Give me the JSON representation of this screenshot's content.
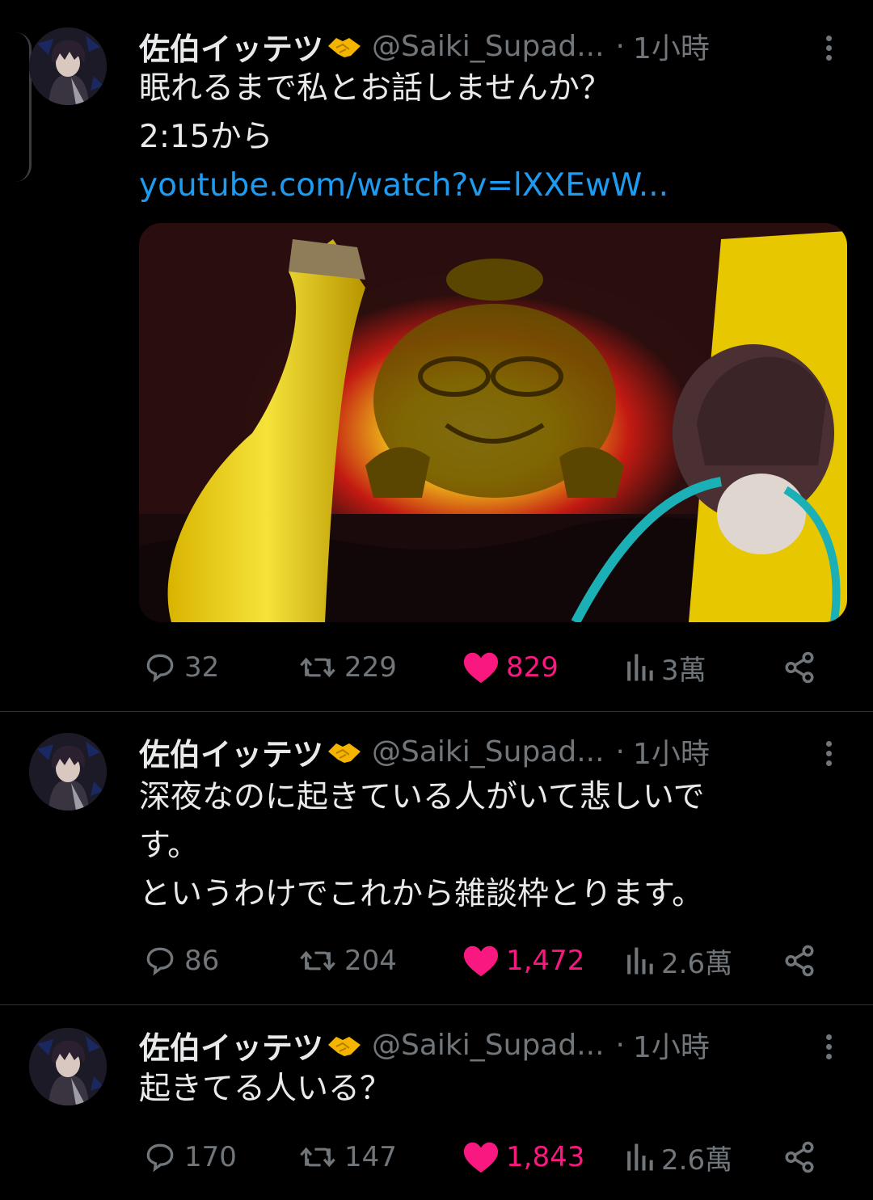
{
  "colors": {
    "background": "#000000",
    "text": "#e7e9ea",
    "muted": "#71767b",
    "link": "#1d9bf0",
    "like": "#f91880"
  },
  "icons": [
    "reply-icon",
    "retweet-icon",
    "heart-icon",
    "views-icon",
    "share-icon",
    "more-icon",
    "handshake-emoji"
  ],
  "tweets": [
    {
      "author": {
        "name": "佐伯イッテツ",
        "handle": "@Saiki_Supad...",
        "time": "1小時"
      },
      "text_lines": [
        "眠れるまで私とお話しませんか？",
        "2:15から"
      ],
      "link": "youtube.com/watch?v=lXXEwW...",
      "has_media": true,
      "stats": {
        "replies": "32",
        "retweets": "229",
        "likes": "829",
        "views": "3萬"
      }
    },
    {
      "author": {
        "name": "佐伯イッテツ",
        "handle": "@Saiki_Supad...",
        "time": "1小時"
      },
      "text_lines": [
        "深夜なのに起きている人がいて悲しいで",
        "す。",
        "というわけでこれから雑談枠とります。"
      ],
      "stats": {
        "replies": "86",
        "retweets": "204",
        "likes": "1,472",
        "views": "2.6萬"
      }
    },
    {
      "author": {
        "name": "佐伯イッテツ",
        "handle": "@Saiki_Supad...",
        "time": "1小時"
      },
      "text_lines": [
        "起きてる人いる？"
      ],
      "stats": {
        "replies": "170",
        "retweets": "147",
        "likes": "1,843",
        "views": "2.6萬"
      }
    }
  ]
}
